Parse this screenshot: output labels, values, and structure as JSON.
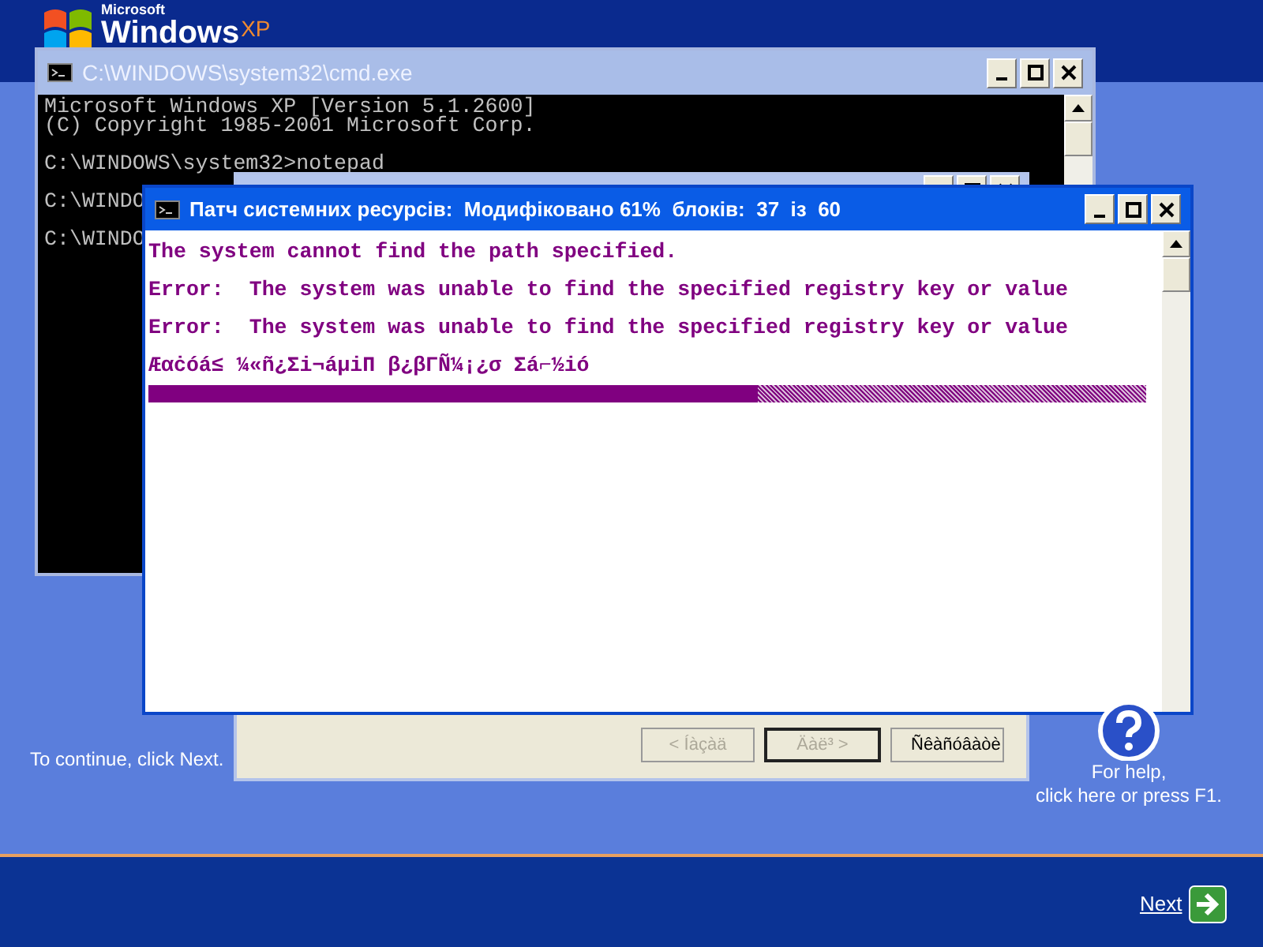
{
  "logo": {
    "maker": "Microsoft",
    "name": "Windows",
    "edition": "XP"
  },
  "cmd_window": {
    "title": "C:\\WINDOWS\\system32\\cmd.exe",
    "blocks": [
      [
        "Microsoft Windows XP [Version 5.1.2600]",
        "(C) Copyright 1985-2001 Microsoft Corp."
      ],
      [
        "C:\\WINDOWS\\system32>notepad"
      ],
      [
        "C:\\WINDO"
      ],
      [
        "C:\\WINDO"
      ]
    ]
  },
  "setup_dialog": {
    "buttons": [
      {
        "label": "< Íàçàä",
        "disabled": true,
        "default": false
      },
      {
        "label": "Äàë³ >",
        "disabled": true,
        "default": true
      },
      {
        "label": "Ñêàñóâàòè",
        "disabled": false,
        "default": false
      }
    ]
  },
  "patch_window": {
    "title": "Патч системних ресурсів:  Модифіковано 61%  блоків:  37  із  60",
    "lines": [
      "The system cannot find the path specified.",
      "Error:  The system was unable to find the specified registry key or value",
      "Error:  The system was unable to find the specified registry key or value",
      "Æαċóá≤ ¼«ñ¿Σi¬áµiΠ β¿βΓÑ¼¡¿σ Σá⌐½ió"
    ],
    "progress": {
      "level": 0.61
    }
  },
  "hint": "To continue, click Next.",
  "help": [
    "For help,",
    "click here or press F1."
  ],
  "next_button": {
    "label": "Next"
  }
}
